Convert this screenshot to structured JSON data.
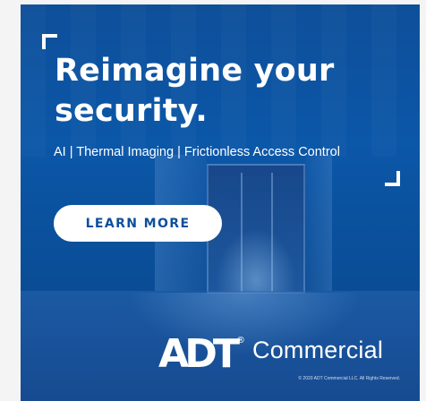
{
  "ad": {
    "headline_line1": "Reimagine your",
    "headline_line2": "security.",
    "subheadline": "AI | Thermal Imaging | Frictionless Access Control",
    "cta_label": "LEARN MORE",
    "brand_logo_text": "ADT",
    "brand_registered_mark": "®",
    "brand_word": "Commercial",
    "copyright": "© 2020 ADT Commercial LLC. All Rights Reserved.",
    "colors": {
      "background_blue": "#0b57a8",
      "cta_text": "#0d4f9c",
      "text": "#ffffff"
    },
    "icons": [
      "corner-bracket-icon",
      "adt-logo-icon"
    ]
  }
}
